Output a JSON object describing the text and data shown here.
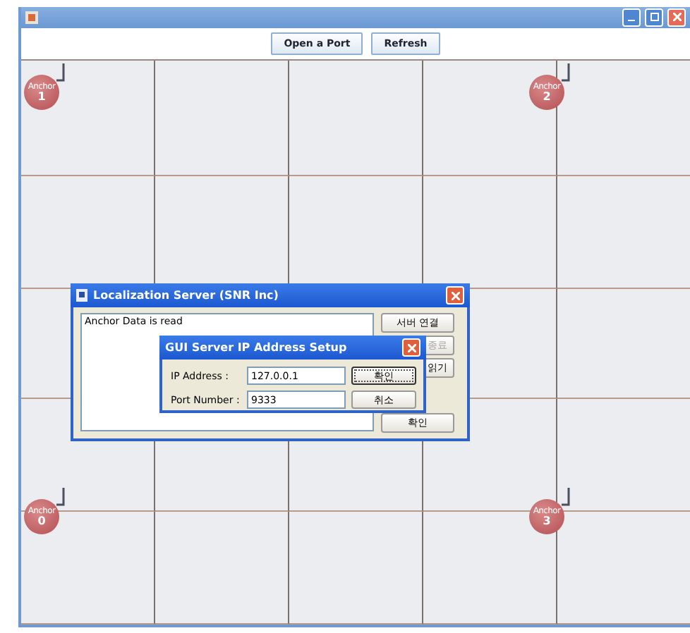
{
  "toolbar": {
    "buttons": [
      "Open a Port",
      "Refresh"
    ]
  },
  "anchors": [
    {
      "label": "Anchor",
      "number": "1"
    },
    {
      "label": "Anchor",
      "number": "2"
    },
    {
      "label": "Anchor",
      "number": "0"
    },
    {
      "label": "Anchor",
      "number": "3"
    }
  ],
  "server_dialog": {
    "title": "Localization Server (SNR Inc)",
    "log": "Anchor Data is read",
    "side_buttons": [
      {
        "label": "서버 연결",
        "disabled": false
      },
      {
        "label": "종료",
        "disabled": true
      },
      {
        "label": "읽기",
        "disabled": false
      }
    ],
    "ok_button": "확인"
  },
  "ip_dialog": {
    "title": "GUI Server IP Address Setup",
    "fields": [
      {
        "label": "IP Address :",
        "value": "127.0.0.1"
      },
      {
        "label": "Port Number :",
        "value": "9333"
      }
    ],
    "buttons": [
      {
        "label": "확인",
        "selected": true
      },
      {
        "label": "취소",
        "selected": false
      }
    ]
  }
}
